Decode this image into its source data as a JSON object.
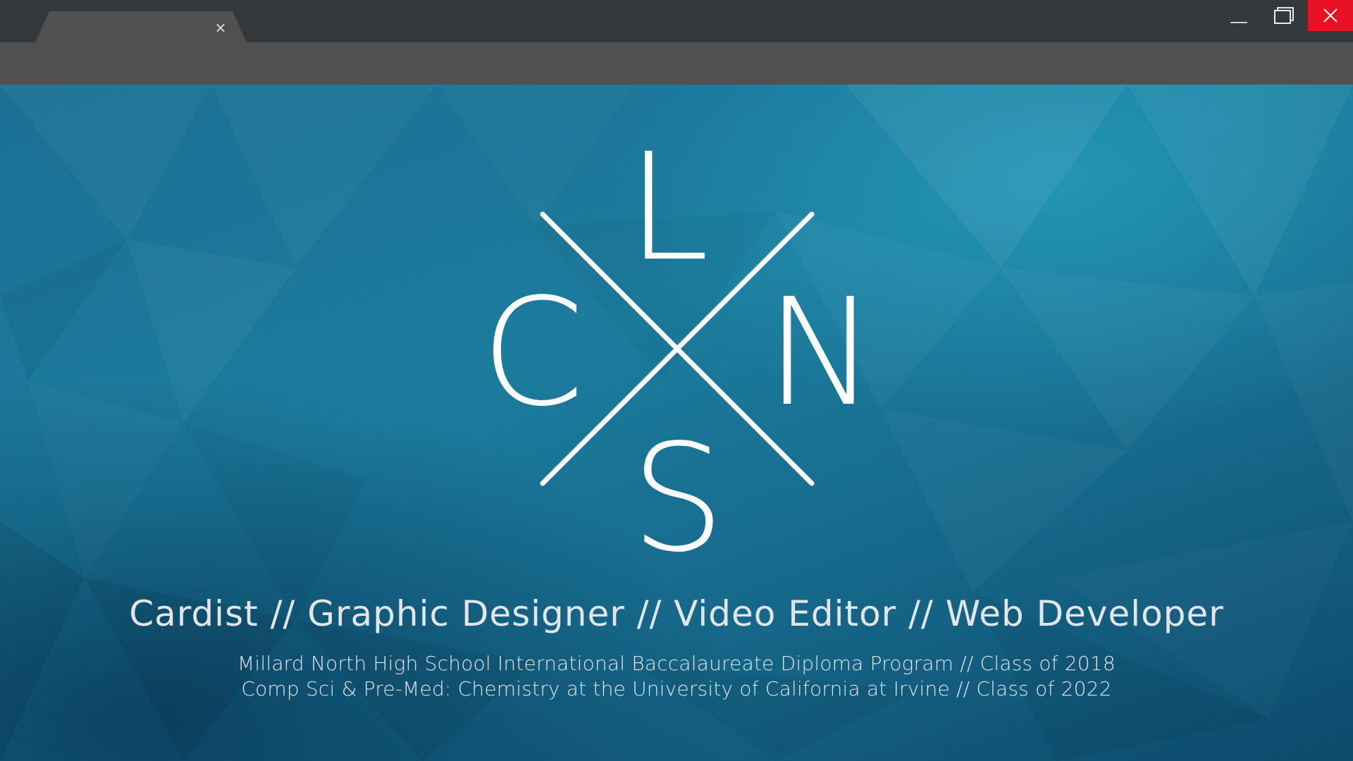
{
  "window": {
    "tab_close_glyph": "×",
    "controls": [
      "minimize-icon",
      "maximize-icon",
      "close-icon"
    ],
    "close_color": "#e81123"
  },
  "logo": {
    "top": "L",
    "left": "C",
    "right": "N",
    "bottom": "S"
  },
  "hero": {
    "headline": "Cardist // Graphic Designer // Video Editor // Web Developer",
    "line1": "Millard North High School International Baccalaureate Diploma Program // Class of 2018",
    "line2": "Comp Sci & Pre-Med: Chemistry at the University of California at Irvine // Class of 2022"
  },
  "colors": {
    "titlebar": "#35383b",
    "toolbar": "#505050",
    "background_teal": "#1c7c9e",
    "text": "#ffffff"
  }
}
